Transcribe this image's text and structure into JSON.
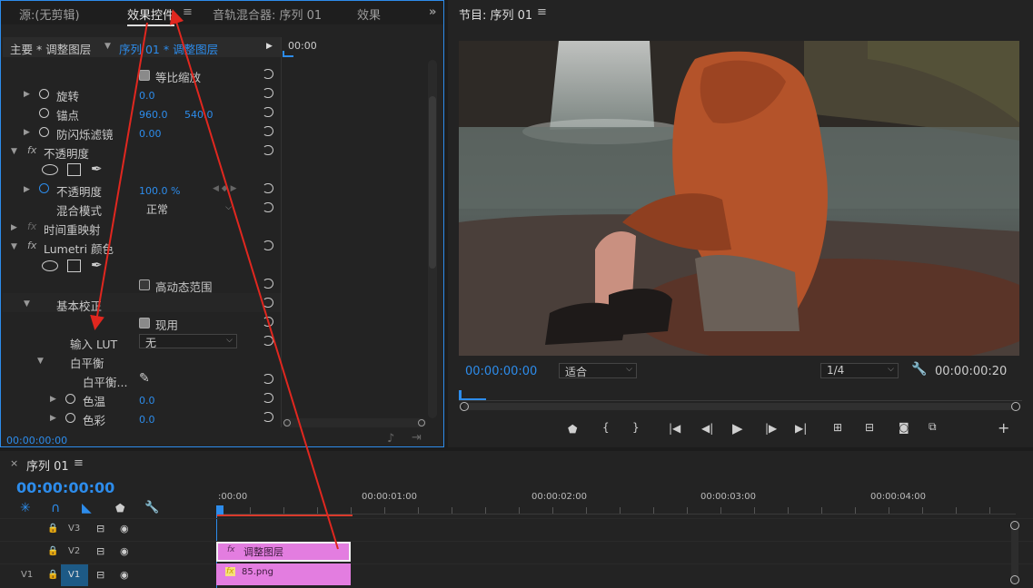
{
  "source_panel": {
    "tabs": {
      "source": "源:(无剪辑)",
      "effect_controls": "效果控件",
      "menu_glyph": "≡",
      "audio_mixer": "音轨混合器: 序列 01",
      "effects": "效果",
      "more": "»"
    },
    "header": {
      "master_label": "主要 * 调整图层",
      "sequence_label": "序列 01 * 调整图层",
      "ruler_time": "00:00"
    },
    "rows": {
      "uniform_scale": "等比缩放",
      "rotation": "旋转",
      "rotation_value": "0.0",
      "anchor": "锚点",
      "anchor_x": "960.0",
      "anchor_y": "540.0",
      "antiflicker": "防闪烁滤镜",
      "antiflicker_value": "0.00",
      "opacity_section": "不透明度",
      "opacity": "不透明度",
      "opacity_value": "100.0 %",
      "blend_mode": "混合模式",
      "blend_mode_value": "正常",
      "time_remap": "时间重映射",
      "lumetri": "Lumetri 颜色",
      "hdr": "高动态范围",
      "basic_correction": "基本校正",
      "present": "现用",
      "input_lut": "输入 LUT",
      "input_lut_value": "无",
      "white_balance": "白平衡",
      "wb_selector": "白平衡...",
      "temperature": "色温",
      "temperature_value": "0.0",
      "tint": "色彩",
      "tint_value": "0.0"
    },
    "footer_time": "00:00:00:00",
    "fx_label": "fx"
  },
  "program_monitor": {
    "title": "节目: 序列 01",
    "menu_glyph": "≡",
    "timecode": "00:00:00:00",
    "fit": "适合",
    "resolution": "1/4",
    "duration": "00:00:00:20",
    "add": "+"
  },
  "timeline": {
    "close": "×",
    "title": "序列 01",
    "menu_glyph": "≡",
    "timecode": "00:00:00:00",
    "ruler": [
      ":00:00",
      "00:00:01:00",
      "00:00:02:00",
      "00:00:03:00",
      "00:00:04:00"
    ],
    "tracks": [
      {
        "src": "",
        "name": "V3"
      },
      {
        "src": "",
        "name": "V2"
      },
      {
        "src": "V1",
        "name": "V1"
      }
    ],
    "clips": {
      "adjustment": "调整图层",
      "image": "85.png",
      "fx": "fx"
    }
  },
  "colors": {
    "accent": "#2d8ceb",
    "clip": "#e37de0",
    "annotation": "#e0271f"
  }
}
